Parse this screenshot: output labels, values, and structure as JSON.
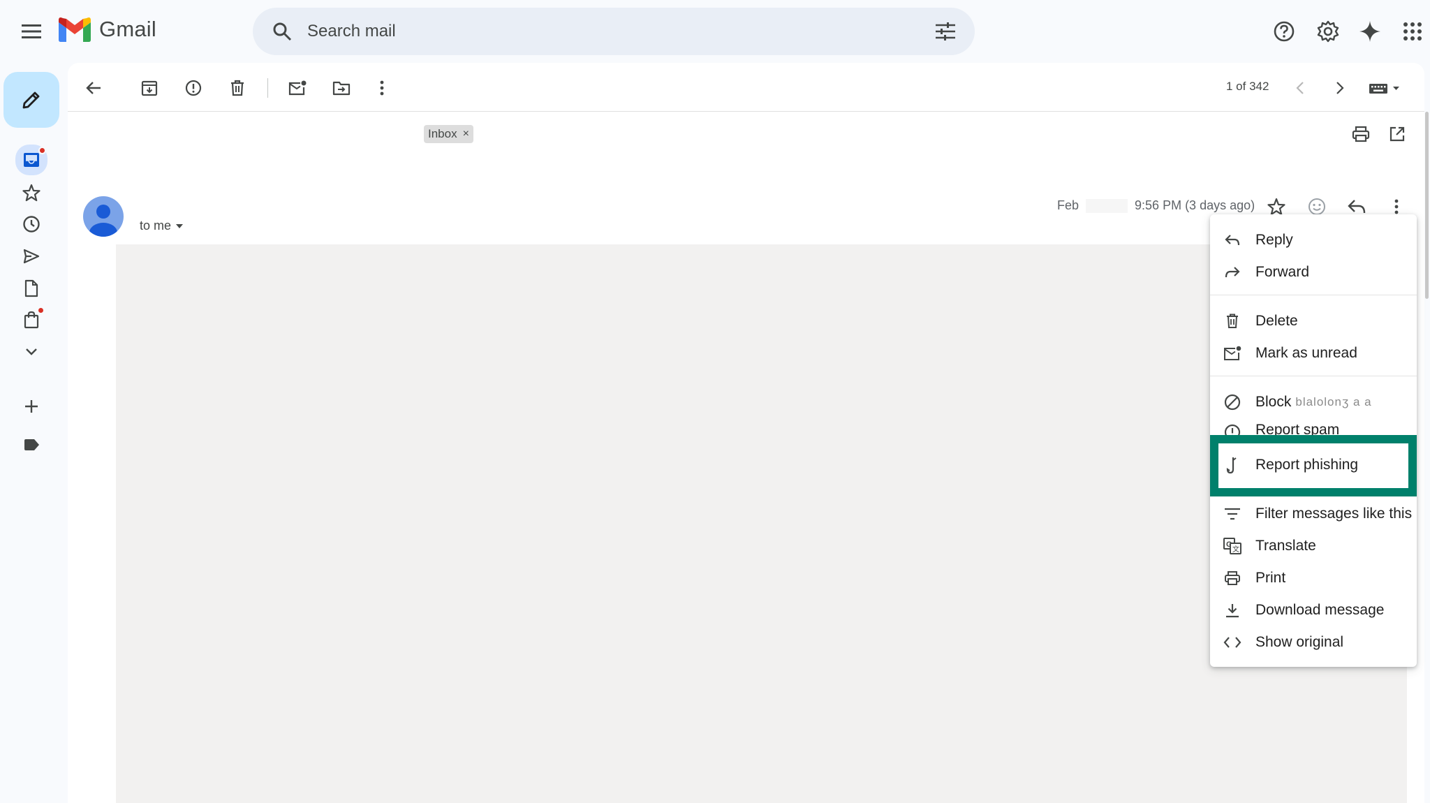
{
  "app": {
    "name": "Gmail"
  },
  "search": {
    "placeholder": "Search mail"
  },
  "toolbar": {
    "pager": "1 of 342"
  },
  "message": {
    "label_chip": "Inbox",
    "label_chip_remove": "×",
    "recipient": "to me",
    "date_prefix": "Feb",
    "time": "9:56 PM (3 days ago)"
  },
  "context_menu": {
    "items": [
      {
        "label": "Reply",
        "icon": "reply-icon"
      },
      {
        "label": "Forward",
        "icon": "forward-icon"
      },
      {
        "label": "Delete",
        "icon": "trash-icon"
      },
      {
        "label": "Mark as unread",
        "icon": "mark-unread-icon"
      },
      {
        "label": "Block",
        "icon": "block-icon",
        "suffix": "blalolonʒ a a"
      },
      {
        "label": "Report spam",
        "icon": "report-spam-icon"
      },
      {
        "label": "Report phishing",
        "icon": "phishing-hook-icon"
      },
      {
        "label": "Filter messages like this",
        "icon": "filter-icon"
      },
      {
        "label": "Translate",
        "icon": "translate-icon"
      },
      {
        "label": "Print",
        "icon": "print-icon"
      },
      {
        "label": "Download message",
        "icon": "download-icon"
      },
      {
        "label": "Show original",
        "icon": "code-icon"
      }
    ]
  },
  "colors": {
    "highlight": "#00806b",
    "compose_bg": "#c2e7ff",
    "search_bg": "#e9eef6",
    "notification_dot": "#d93025"
  }
}
